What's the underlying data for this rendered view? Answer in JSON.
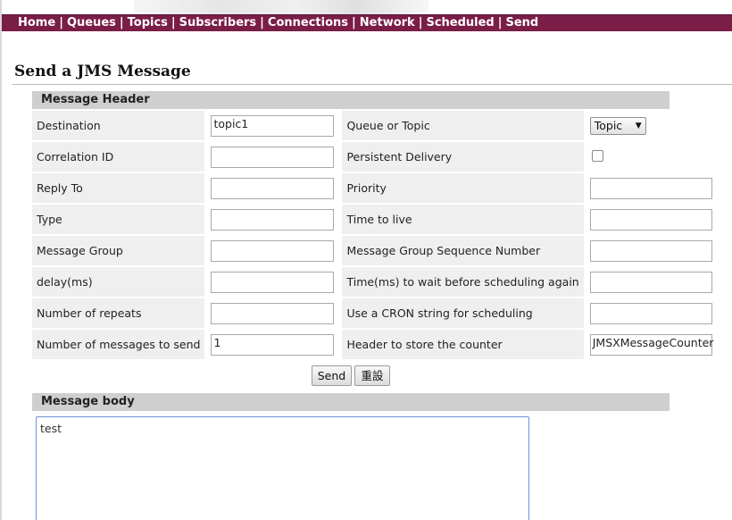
{
  "nav": {
    "items": [
      "Home",
      "Queues",
      "Topics",
      "Subscribers",
      "Connections",
      "Network",
      "Scheduled",
      "Send"
    ],
    "separator": "|"
  },
  "page_title": "Send a JMS Message",
  "header_section": {
    "title": "Message Header",
    "rows": [
      {
        "left_label": "Destination",
        "left_value": "topic1",
        "right_label": "Queue or Topic",
        "right_value": "Topic"
      },
      {
        "left_label": "Correlation ID",
        "left_value": "",
        "right_label": "Persistent Delivery",
        "right_value": false
      },
      {
        "left_label": "Reply To",
        "left_value": "",
        "right_label": "Priority",
        "right_value": ""
      },
      {
        "left_label": "Type",
        "left_value": "",
        "right_label": "Time to live",
        "right_value": ""
      },
      {
        "left_label": "Message Group",
        "left_value": "",
        "right_label": "Message Group Sequence Number",
        "right_value": ""
      },
      {
        "left_label": "delay(ms)",
        "left_value": "",
        "right_label": "Time(ms) to wait before scheduling again",
        "right_value": ""
      },
      {
        "left_label": "Number of repeats",
        "left_value": "",
        "right_label": "Use a CRON string for scheduling",
        "right_value": ""
      },
      {
        "left_label": "Number of messages to send",
        "left_value": "1",
        "right_label": "Header to store the counter",
        "right_value": "JMSXMessageCounter"
      }
    ]
  },
  "buttons": {
    "send": "Send",
    "reset": "重設"
  },
  "body_section": {
    "title": "Message body",
    "value": "test"
  },
  "colors": {
    "navbar": "#7a1d47",
    "section_header": "#cfcfcf",
    "label_cell": "#efefef"
  }
}
